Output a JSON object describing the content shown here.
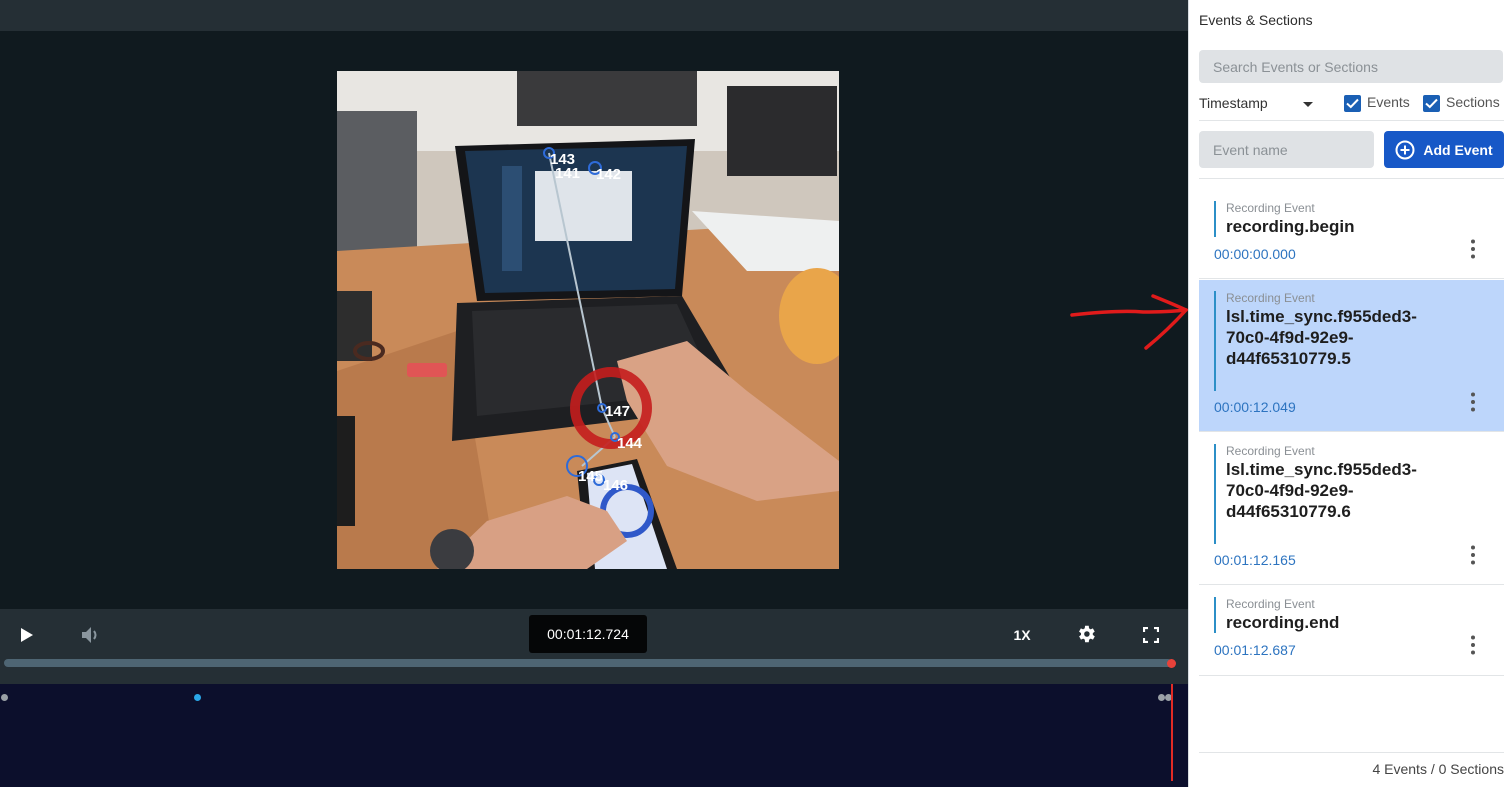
{
  "player": {
    "time_display": "00:01:12.724",
    "speed_label": "1X",
    "progress": 0.999,
    "icons": {
      "play": "play-icon",
      "volume": "volume-icon",
      "settings": "gear-icon",
      "fullscreen": "fullscreen-icon"
    },
    "overlay_labels": [
      "143",
      "141",
      "142",
      "147",
      "144",
      "145",
      "146"
    ]
  },
  "panel": {
    "title": "Events & Sections",
    "search_placeholder": "Search Events or Sections",
    "sort_label": "Timestamp",
    "filter_events_label": "Events",
    "filter_sections_label": "Sections",
    "event_name_placeholder": "Event name",
    "add_event_label": "Add Event",
    "events": [
      {
        "type": "Recording Event",
        "name": "recording.begin",
        "time": "00:00:00.000",
        "selected": false
      },
      {
        "type": "Recording Event",
        "name": "lsl.time_sync.f955ded3-70c0-4f9d-92e9-d44f65310779.5",
        "time": "00:00:12.049",
        "selected": true
      },
      {
        "type": "Recording Event",
        "name": "lsl.time_sync.f955ded3-70c0-4f9d-92e9-d44f65310779.6",
        "time": "00:01:12.165",
        "selected": false
      },
      {
        "type": "Recording Event",
        "name": "recording.end",
        "time": "00:01:12.687",
        "selected": false
      }
    ],
    "footer": "4 Events / 0 Sections"
  },
  "colors": {
    "accent": "#1758c7",
    "selected_row": "#bdd6fb",
    "playhead": "#e32b25",
    "annotation": "#e01b1b"
  }
}
